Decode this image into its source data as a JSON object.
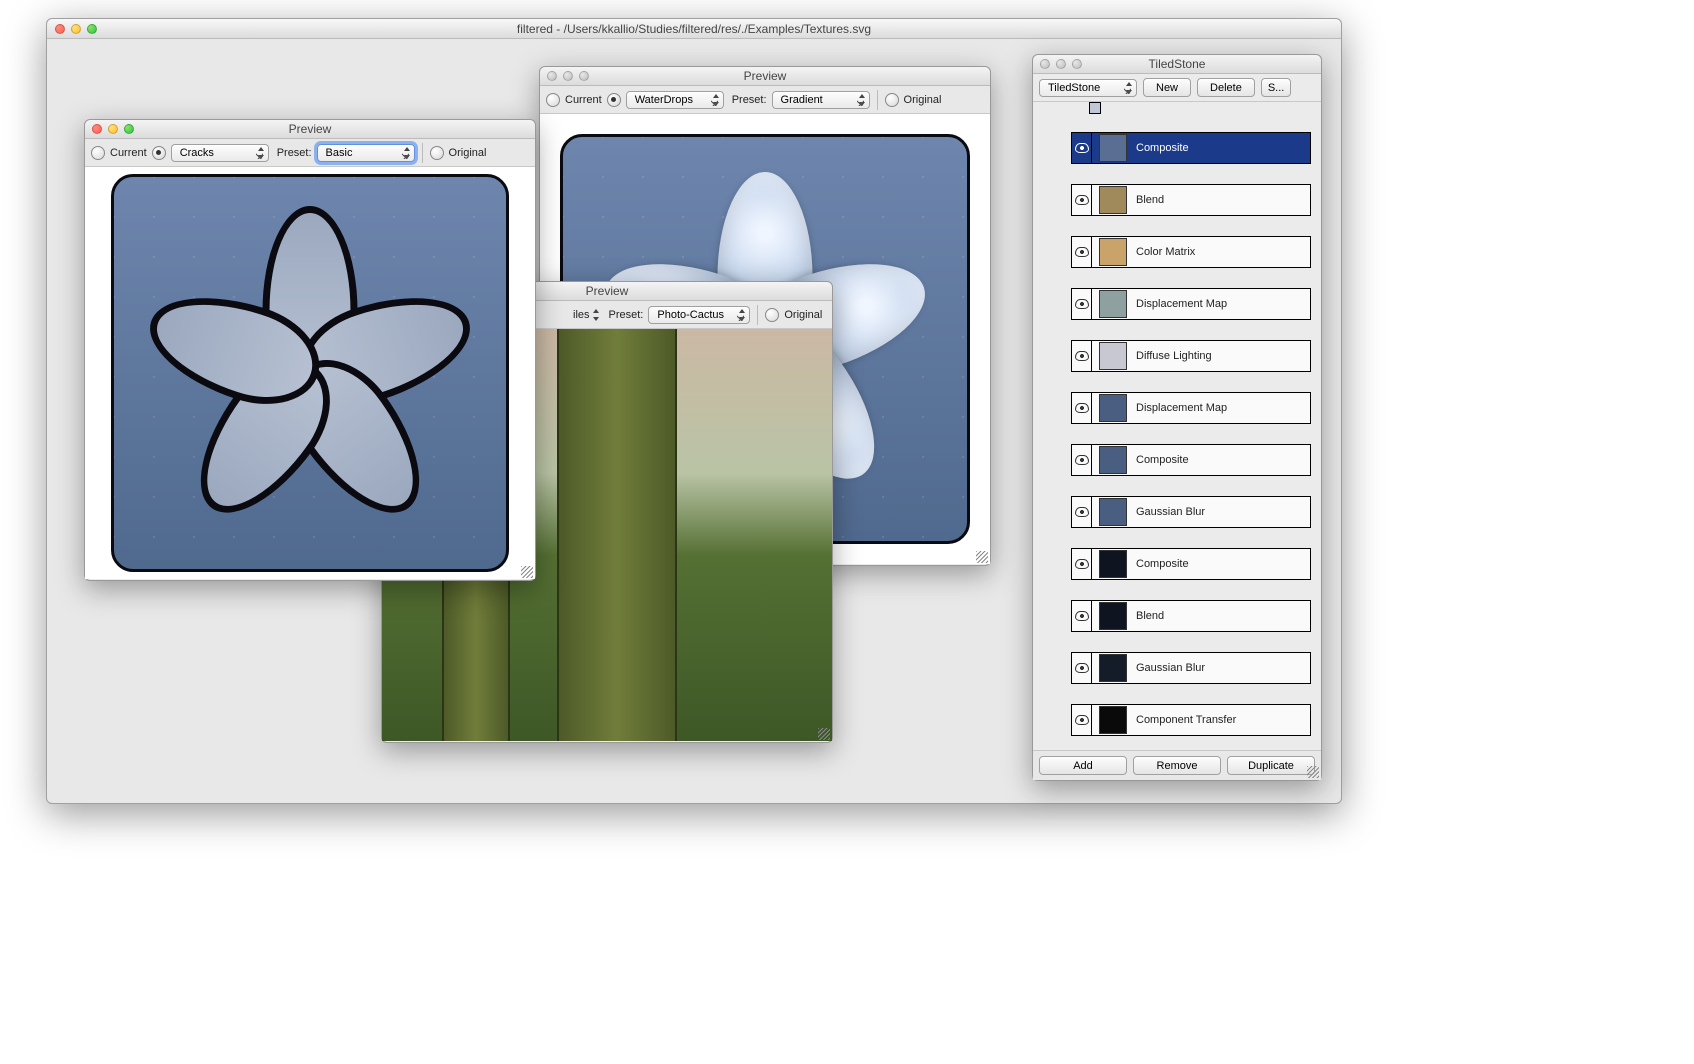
{
  "main_window": {
    "title": "filtered - /Users/kkallio/Studies/filtered/res/./Examples/Textures.svg"
  },
  "preview1": {
    "title": "Preview",
    "current_label": "Current",
    "filter_value": "Cracks",
    "preset_label": "Preset:",
    "preset_value": "Basic",
    "original_label": "Original"
  },
  "preview2": {
    "title": "Preview",
    "current_label": "Current",
    "filter_value": "WaterDrops",
    "preset_label": "Preset:",
    "preset_value": "Gradient",
    "original_label": "Original"
  },
  "preview3": {
    "title": "Preview",
    "iles_label": "iles",
    "preset_label": "Preset:",
    "preset_value": "Photo-Cactus",
    "original_label": "Original"
  },
  "inspector": {
    "title": "TiledStone",
    "filter_value": "TiledStone",
    "new_label": "New",
    "delete_label": "Delete",
    "s_label": "S...",
    "add_label": "Add",
    "remove_label": "Remove",
    "duplicate_label": "Duplicate",
    "nodes": [
      {
        "label": "Composite",
        "thumb": "#5a6e94",
        "selected": true
      },
      {
        "label": "Blend",
        "thumb": "#a08a5c",
        "selected": false
      },
      {
        "label": "Color Matrix",
        "thumb": "#c9a36a",
        "selected": false
      },
      {
        "label": "Displacement Map",
        "thumb": "#8ea0a0",
        "selected": false
      },
      {
        "label": "Diffuse Lighting",
        "thumb": "#c8c8d2",
        "selected": false
      },
      {
        "label": "Displacement Map",
        "thumb": "#4a5e82",
        "selected": false
      },
      {
        "label": "Composite",
        "thumb": "#4a5e82",
        "selected": false
      },
      {
        "label": "Gaussian Blur",
        "thumb": "#4a5e82",
        "selected": false
      },
      {
        "label": "Composite",
        "thumb": "#0e1420",
        "selected": false
      },
      {
        "label": "Blend",
        "thumb": "#0e1420",
        "selected": false
      },
      {
        "label": "Gaussian Blur",
        "thumb": "#141c2a",
        "selected": false
      },
      {
        "label": "Component Transfer",
        "thumb": "#0a0a0a",
        "selected": false
      }
    ]
  }
}
